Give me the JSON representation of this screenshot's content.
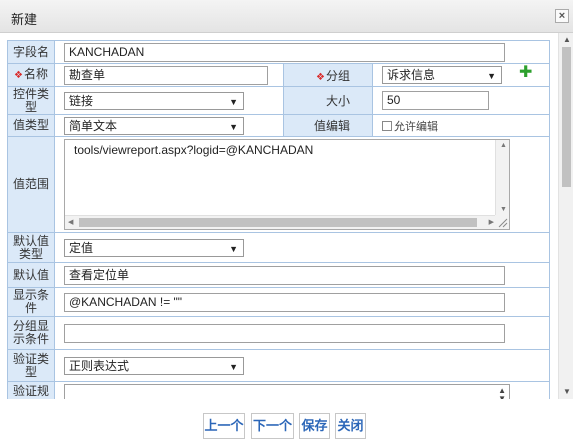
{
  "window": {
    "title": "新建",
    "close_glyph": "×"
  },
  "form": {
    "field_name": {
      "label": "字段名",
      "value": "KANCHADAN"
    },
    "name": {
      "label": "名称",
      "value": "勘查单"
    },
    "group": {
      "label": "分组",
      "value": "诉求信息"
    },
    "control_type": {
      "label": "控件类型",
      "value": "链接"
    },
    "size": {
      "label": "大小",
      "value": "50"
    },
    "value_type": {
      "label": "值类型",
      "value": "简单文本"
    },
    "value_edit": {
      "label": "值编辑",
      "checkbox_label": "允许编辑"
    },
    "value_range": {
      "label": "值范围",
      "value": "tools/viewreport.aspx?logid=@KANCHADAN"
    },
    "default_type": {
      "label": "默认值类型",
      "value": "定值"
    },
    "default_value": {
      "label": "默认值",
      "value": "查看定位单"
    },
    "display_condition": {
      "label": "显示条件",
      "value": "@KANCHADAN != \"\""
    },
    "group_display_condition": {
      "label": "分组显示条件",
      "value": ""
    },
    "validation_type": {
      "label": "验证类型",
      "value": "正则表达式"
    },
    "validation_rule": {
      "label": "验证规",
      "value": ""
    }
  },
  "buttons": {
    "prev": "上一个",
    "next": "下一个",
    "save": "保存",
    "close": "关闭"
  },
  "icons": {
    "required": "diamond-icon",
    "add": "plus-icon"
  },
  "colors": {
    "label_bg": "#dbe9f8",
    "border": "#a9c4e2",
    "button_text": "#2b66b8",
    "required": "#d92b2b",
    "add": "#2da02d"
  }
}
